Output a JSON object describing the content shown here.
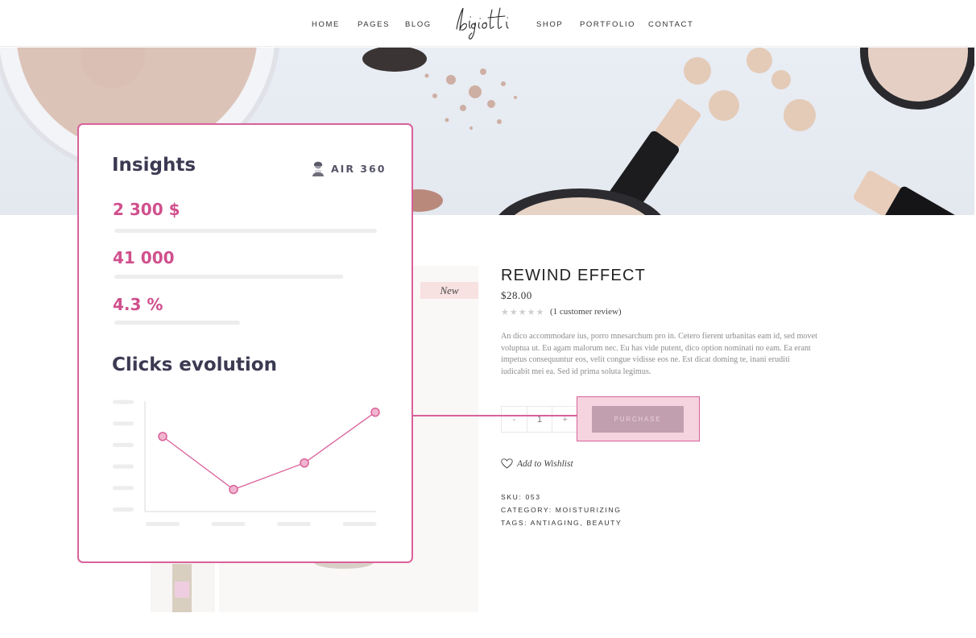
{
  "nav": {
    "left": [
      "HOME",
      "PAGES",
      "BLOG"
    ],
    "right": [
      "SHOP",
      "PORTFOLIO",
      "CONTACT"
    ],
    "logo": "biagiotti"
  },
  "product": {
    "badge": "New",
    "title": "REWIND EFFECT",
    "price": "$28.00",
    "stars": "★★★★★",
    "review": "(1 customer review)",
    "description": "An dico accommodare ius, porro mnesarchum pro in. Cetero fierent urbanitas eam id, sed movet voluptua ut. Eu agam malorum nec. Eu has vide putent, dico option nominati no eam. Ea erant impetus consequuntur eos, velit congue vidisse eos ne. Est dicat doming te, inani eruditi iudicabit mei ea. Sed id prima soluta legimus.",
    "qty_minus": "-",
    "qty_value": "1",
    "qty_plus": "+",
    "purchase": "PURCHASE",
    "wishlist": "Add to Wishlist",
    "sku_label": "SKU:",
    "sku": "053",
    "category_label": "CATEGORY:",
    "category": "MOISTURIZING",
    "tags_label": "TAGS:",
    "tags": "ANTIAGING, BEAUTY"
  },
  "insights": {
    "title": "Insights",
    "brand": "AIR 360",
    "metrics": [
      {
        "value": "2 300 $",
        "fill": 1.0
      },
      {
        "value": "41 000",
        "fill": 0.87
      },
      {
        "value": "4.3 %",
        "fill": 0.48
      }
    ],
    "subtitle": "Clicks evolution"
  },
  "chart_data": {
    "type": "line",
    "title": "Clicks evolution",
    "x": [
      1,
      2,
      3,
      4
    ],
    "series": [
      {
        "values": [
          3.4,
          1.0,
          2.2,
          4.5
        ]
      }
    ],
    "ylim": [
      0,
      5
    ],
    "grid": false,
    "accent": "#d9619a"
  },
  "colors": {
    "accent": "#d9619a",
    "metric": "#d0508d",
    "purchase_bg": "#c29fae",
    "badge_bg": "#f8e1e1"
  }
}
